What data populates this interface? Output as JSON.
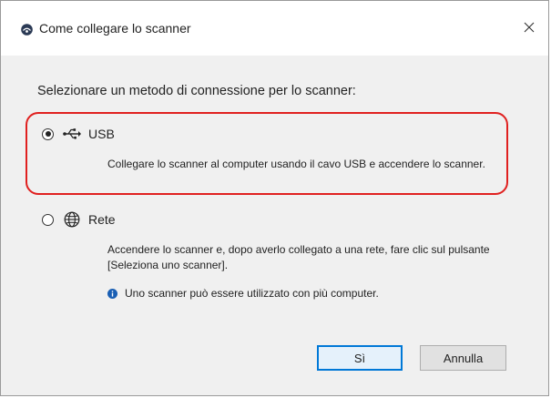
{
  "window": {
    "title": "Come collegare lo scanner"
  },
  "content": {
    "instruction": "Selezionare un metodo di connessione per lo scanner:",
    "options": [
      {
        "label": "USB",
        "selected": true,
        "icon": "usb-icon",
        "description": "Collegare lo scanner al computer usando il cavo USB e accendere lo scanner."
      },
      {
        "label": "Rete",
        "selected": false,
        "icon": "globe-icon",
        "description": "Accendere lo scanner e, dopo averlo collegato a una rete, fare clic sul pulsante [Seleziona uno scanner].",
        "info": "Uno scanner può essere utilizzato con più computer."
      }
    ]
  },
  "buttons": {
    "yes_label": "Sì",
    "cancel_label": "Annulla"
  },
  "colors": {
    "highlight_border": "#e0201f",
    "info_icon": "#1a5fb4",
    "default_button_border": "#0078d7"
  }
}
